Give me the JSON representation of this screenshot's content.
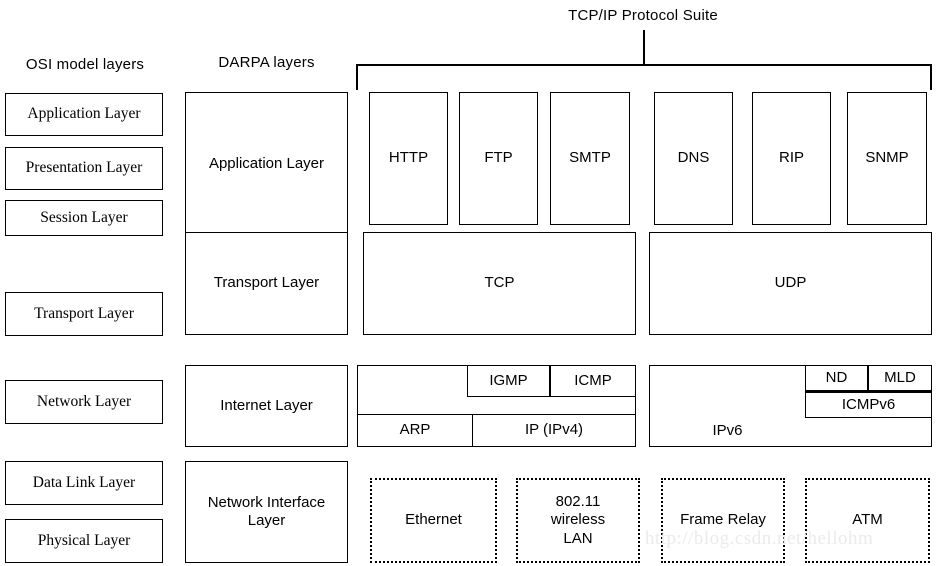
{
  "figure": {
    "title": "TCP/IP Protocol Suite",
    "column_headers": {
      "osi": "OSI model layers",
      "darpa": "DARPA layers"
    },
    "watermark": "http://blog.csdn.net/hellohm"
  },
  "osi_layers": [
    {
      "label": "Application Layer"
    },
    {
      "label": "Presentation Layer"
    },
    {
      "label": "Session Layer"
    },
    {
      "label": "Transport Layer"
    },
    {
      "label": "Network Layer"
    },
    {
      "label": "Data Link Layer"
    },
    {
      "label": "Physical Layer"
    }
  ],
  "darpa_layers": [
    {
      "label": "Application Layer"
    },
    {
      "label": "Transport Layer"
    },
    {
      "label": "Internet Layer"
    },
    {
      "label": "Network Interface Layer"
    }
  ],
  "application_protocols": {
    "tcp_group": [
      {
        "label": "HTTP"
      },
      {
        "label": "FTP"
      },
      {
        "label": "SMTP"
      }
    ],
    "udp_group": [
      {
        "label": "DNS"
      },
      {
        "label": "RIP"
      },
      {
        "label": "SNMP"
      }
    ]
  },
  "transport_protocols": [
    {
      "label": "TCP"
    },
    {
      "label": "UDP"
    }
  ],
  "internet_layer": {
    "ipv4_stack": {
      "igmp": "IGMP",
      "icmp": "ICMP",
      "arp": "ARP",
      "ip": "IP (IPv4)"
    },
    "ipv6_stack": {
      "nd": "ND",
      "mld": "MLD",
      "icmpv6": "ICMPv6",
      "ipv6": "IPv6"
    }
  },
  "network_interface_technologies": [
    {
      "label": "Ethernet"
    },
    {
      "label": "802.11\nwireless\nLAN",
      "line1": "802.11",
      "line2": "wireless",
      "line3": "LAN"
    },
    {
      "label": "Frame Relay"
    },
    {
      "label": "ATM"
    }
  ],
  "colors": {
    "stroke": "#000000",
    "background": "#ffffff",
    "watermark": "#eceaea"
  }
}
